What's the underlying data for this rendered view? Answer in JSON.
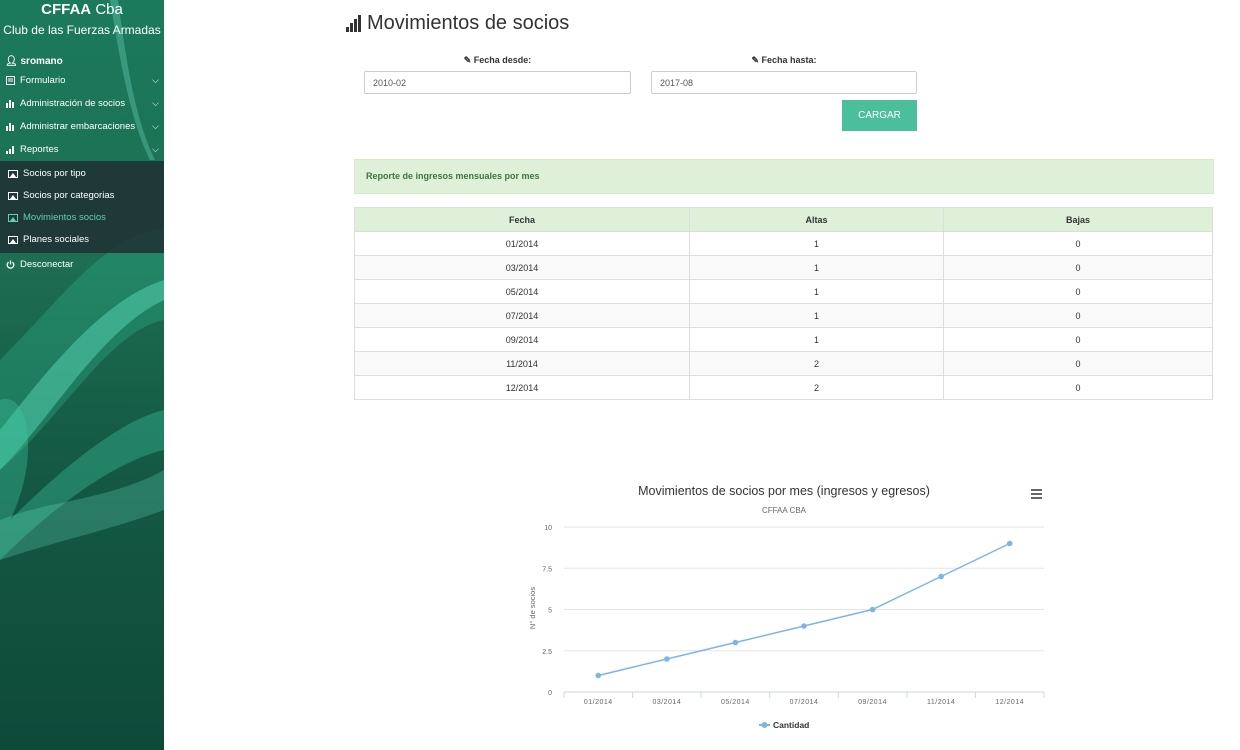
{
  "brand": {
    "name_bold": "CFFAA",
    "name_rest": "Cba",
    "subtitle": "Club de las Fuerzas Armadas"
  },
  "user": {
    "name": "sromano"
  },
  "menu": {
    "formulario": "Formulario",
    "admin_socios": "Administración de socios",
    "admin_embarcaciones": "Administrar embarcaciones",
    "reportes": "Reportes",
    "sub": [
      "Socios por tipo",
      "Socios por categorias",
      "Movimientos socios",
      "Planes sociales"
    ],
    "active_sub_index": 2,
    "logout": "Desconectar"
  },
  "page": {
    "title": "Movimientos de socios"
  },
  "filters": {
    "from_label": "Fecha desde:",
    "from_value": "2010-02",
    "to_label": "Fecha hasta:",
    "to_value": "2017-08",
    "submit_label": "CARGAR"
  },
  "report": {
    "heading": "Reporte de ingresos mensuales por mes"
  },
  "table": {
    "headers": [
      "Fecha",
      "Altas",
      "Bajas"
    ],
    "rows": [
      [
        "01/2014",
        "1",
        "0"
      ],
      [
        "03/2014",
        "1",
        "0"
      ],
      [
        "05/2014",
        "1",
        "0"
      ],
      [
        "07/2014",
        "1",
        "0"
      ],
      [
        "09/2014",
        "1",
        "0"
      ],
      [
        "11/2014",
        "2",
        "0"
      ],
      [
        "12/2014",
        "2",
        "0"
      ]
    ]
  },
  "colors": {
    "accent": "#4bbf9c",
    "series": "#7cb5ec",
    "active_menu": "#5ed1b0"
  },
  "chart_data": {
    "type": "line",
    "title": "Movimientos de socios por mes (ingresos y egresos)",
    "subtitle": "CFFAA CBA",
    "ylabel": "N° de socios",
    "xlabel": "",
    "categories": [
      "01/2014",
      "03/2014",
      "05/2014",
      "07/2014",
      "09/2014",
      "11/2014",
      "12/2014"
    ],
    "series": [
      {
        "name": "Cantidad",
        "values": [
          1,
          2,
          3,
          4,
          5,
          7,
          9
        ]
      }
    ],
    "ylim": [
      0,
      10
    ],
    "yticks": [
      "0",
      "2.5",
      "5",
      "7.5",
      "10"
    ],
    "grid": true,
    "legend": "bottom-center"
  }
}
